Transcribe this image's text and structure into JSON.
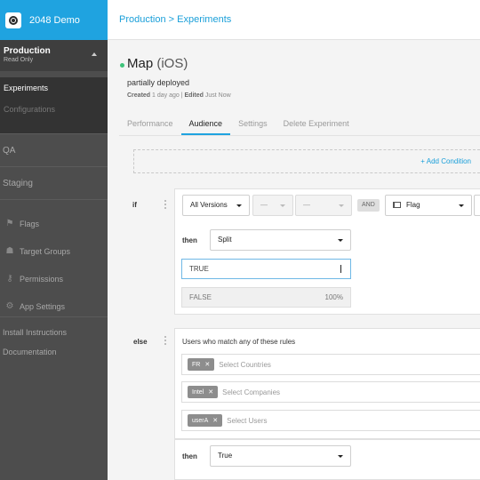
{
  "app": {
    "name": "2048 Demo"
  },
  "sidebar": {
    "environment": {
      "title": "Production",
      "subtitle": "Read Only"
    },
    "env_items": [
      {
        "label": "Experiments",
        "active": true
      },
      {
        "label": "Configurations",
        "active": false
      }
    ],
    "sections": [
      {
        "label": "QA"
      },
      {
        "label": "Staging"
      }
    ],
    "links": [
      {
        "label": "Flags",
        "icon": "flag-icon"
      },
      {
        "label": "Target Groups",
        "icon": "users-icon"
      },
      {
        "label": "Permissions",
        "icon": "key-icon"
      },
      {
        "label": "App Settings",
        "icon": "gear-icon"
      }
    ],
    "bottom_links": [
      {
        "label": "Install Instructions"
      },
      {
        "label": "Documentation"
      }
    ]
  },
  "topbar": {
    "breadcrumb": "Production > Experiments"
  },
  "experiment": {
    "name": "Map",
    "platform": "(iOS)",
    "status": "partially deployed",
    "created_label": "Created",
    "created_value": "1 day ago",
    "separator": "|",
    "edited_label": "Edited",
    "edited_value": "Just Now",
    "status_color": "#3ec47a"
  },
  "tabs": [
    {
      "label": "Performance",
      "active": false
    },
    {
      "label": "Audience",
      "active": true
    },
    {
      "label": "Settings",
      "active": false
    },
    {
      "label": "Delete Experiment",
      "active": false
    }
  ],
  "audience": {
    "add_condition": "+ Add Condition",
    "if_label": "if",
    "version_select": "All Versions",
    "dash_select_1": "—",
    "dash_select_2": "—",
    "and_label": "AND",
    "flag_select": "Flag",
    "then_label": "then",
    "then_select": "Split",
    "split_rows": [
      {
        "label": "TRUE",
        "value": ""
      },
      {
        "label": "FALSE",
        "value": "100%"
      }
    ],
    "else_label": "else",
    "else_title": "Users who match any of these rules",
    "rule_rows": [
      {
        "tag": "FR",
        "placeholder": "Select Countries"
      },
      {
        "tag": "Intel",
        "placeholder": "Select Companies"
      },
      {
        "tag": "userA",
        "placeholder": "Select Users"
      }
    ],
    "else_then_label": "then",
    "else_then_select": "True"
  },
  "colors": {
    "accent": "#1fa3e0",
    "sidebar": "#4d4d4d"
  }
}
